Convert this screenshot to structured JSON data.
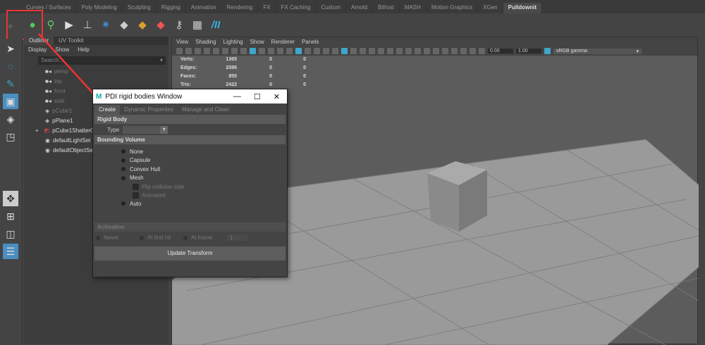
{
  "shelf_tabs": [
    "Curves / Surfaces",
    "Poly Modeling",
    "Sculpting",
    "Rigging",
    "Animation",
    "Rendering",
    "FX",
    "FX Caching",
    "Custom",
    "Arnold",
    "Bifrost",
    "MASH",
    "Motion Graphics",
    "XGen",
    "Pulldownit"
  ],
  "active_shelf_tab": "Pulldownit",
  "shelf_icons": [
    "bowling-pins-icon",
    "pin-icon",
    "play-gear-icon",
    "broom-icon",
    "star-wand-icon",
    "shatter-gray-icon",
    "shatter-gold-icon",
    "shatter-color-icon",
    "key-icon",
    "fracture-block-icon",
    "pdi-logo-icon"
  ],
  "outliner": {
    "tabs": [
      "Outliner",
      "UV Toolkit"
    ],
    "menu": [
      "Display",
      "Show",
      "Help"
    ],
    "search_placeholder": "Search...",
    "items": [
      {
        "label": "persp",
        "icon": "camera-icon",
        "dim": true
      },
      {
        "label": "top",
        "icon": "camera-icon",
        "dim": true
      },
      {
        "label": "front",
        "icon": "camera-icon",
        "dim": true
      },
      {
        "label": "side",
        "icon": "camera-icon",
        "dim": true
      },
      {
        "label": "pCube1",
        "icon": "mesh-icon",
        "dim": true
      },
      {
        "label": "pPlane1",
        "icon": "mesh-icon",
        "dim": false
      },
      {
        "label": "pCube1ShatterG",
        "icon": "shatter-group-icon",
        "dim": false,
        "expand": "+"
      },
      {
        "label": "defaultLightSet",
        "icon": "set-icon",
        "dim": false
      },
      {
        "label": "defaultObjectSe",
        "icon": "set-icon",
        "dim": false
      }
    ]
  },
  "viewport": {
    "menu": [
      "View",
      "Shading",
      "Lighting",
      "Show",
      "Renderer",
      "Panels"
    ],
    "exposure": "0.00",
    "gamma": "1.00",
    "color_space": "sRGB gamma",
    "hud": [
      [
        "Verts:",
        "1365",
        "0",
        "0"
      ],
      [
        "Edges:",
        "2086",
        "0",
        "0"
      ],
      [
        "Faces:",
        "850",
        "0",
        "0"
      ],
      [
        "Tris:",
        "2422",
        "0",
        "0"
      ]
    ]
  },
  "dialog": {
    "title": "PDI rigid bodies Window",
    "tabs": [
      "Create",
      "Dynamic Properties",
      "Manage and Clean"
    ],
    "rigid_body": "Rigid Body",
    "type_label": "Type",
    "type_value": "",
    "bounding_volume": "Bounding Volume",
    "bv_options": [
      "None",
      "Capsule",
      "Convex Hull",
      "Mesh"
    ],
    "mesh_options": [
      "Flip collision side",
      "Animated"
    ],
    "auto": "Auto",
    "activation": "Activation",
    "activation_options": [
      "Never",
      "At first hit",
      "At frame"
    ],
    "frame_value": "1",
    "update_button": "Update Transform"
  },
  "colors": {
    "accent": "#4b8ec0",
    "highlight": "#e33333"
  }
}
